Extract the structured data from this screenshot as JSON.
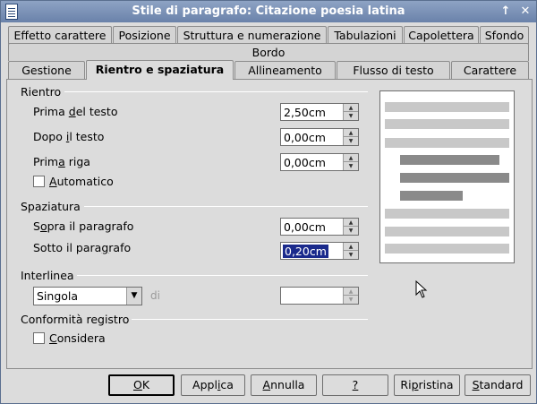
{
  "window": {
    "title": "Stile di paragrafo: Citazione poesia latina",
    "title_buttons": [
      "↑",
      "✕"
    ]
  },
  "tabs_row1": [
    "Effetto carattere",
    "Posizione",
    "Struttura e numerazione",
    "Tabulazioni",
    "Capolettera",
    "Sfondo"
  ],
  "tabs_row2": [
    "Bordo"
  ],
  "tabs_row3": [
    "Gestione",
    "Rientro e spaziatura",
    "Allineamento",
    "Flusso di testo",
    "Carattere"
  ],
  "active_tab": "Rientro e spaziatura",
  "rientro": {
    "title": "Rientro",
    "prima_del_testo": {
      "pre": "Prima ",
      "ul": "d",
      "post": "el testo",
      "value": "2,50cm"
    },
    "dopo_il_testo": {
      "pre": "Dopo ",
      "ul": "i",
      "post": "l testo",
      "value": "0,00cm"
    },
    "prima_riga": {
      "pre": "Prim",
      "ul": "a",
      "post": " riga",
      "value": "0,00cm"
    },
    "automatico": {
      "pre": "",
      "ul": "A",
      "post": "utomatico",
      "checked": false
    }
  },
  "spaziatura": {
    "title": "Spaziatura",
    "sopra": {
      "pre": "S",
      "ul": "o",
      "post": "pra il paragrafo",
      "value": "0,00cm"
    },
    "sotto": {
      "pre": "Sotto il para",
      "ul": "g",
      "post": "rafo",
      "value": "0,20cm"
    }
  },
  "interlinea": {
    "title": "Interlinea",
    "selected": "Singola",
    "di_label": "di",
    "di_value": ""
  },
  "conformita": {
    "title": "Conformità registro",
    "considera": {
      "pre": "",
      "ul": "C",
      "post": "onsidera",
      "checked": false
    }
  },
  "preview_colors": {
    "light": "#c8c8c8",
    "dark": "#8a8a8a"
  },
  "buttons": {
    "ok": {
      "pre": "",
      "ul": "O",
      "post": "K"
    },
    "applica": {
      "pre": "Appl",
      "ul": "i",
      "post": "ca"
    },
    "annulla": {
      "pre": "",
      "ul": "A",
      "post": "nnulla"
    },
    "help": {
      "pre": "",
      "ul": "?",
      "post": ""
    },
    "ripristina": {
      "pre": "Ri",
      "ul": "p",
      "post": "ristina"
    },
    "standard": {
      "pre": "",
      "ul": "S",
      "post": "tandard"
    }
  }
}
